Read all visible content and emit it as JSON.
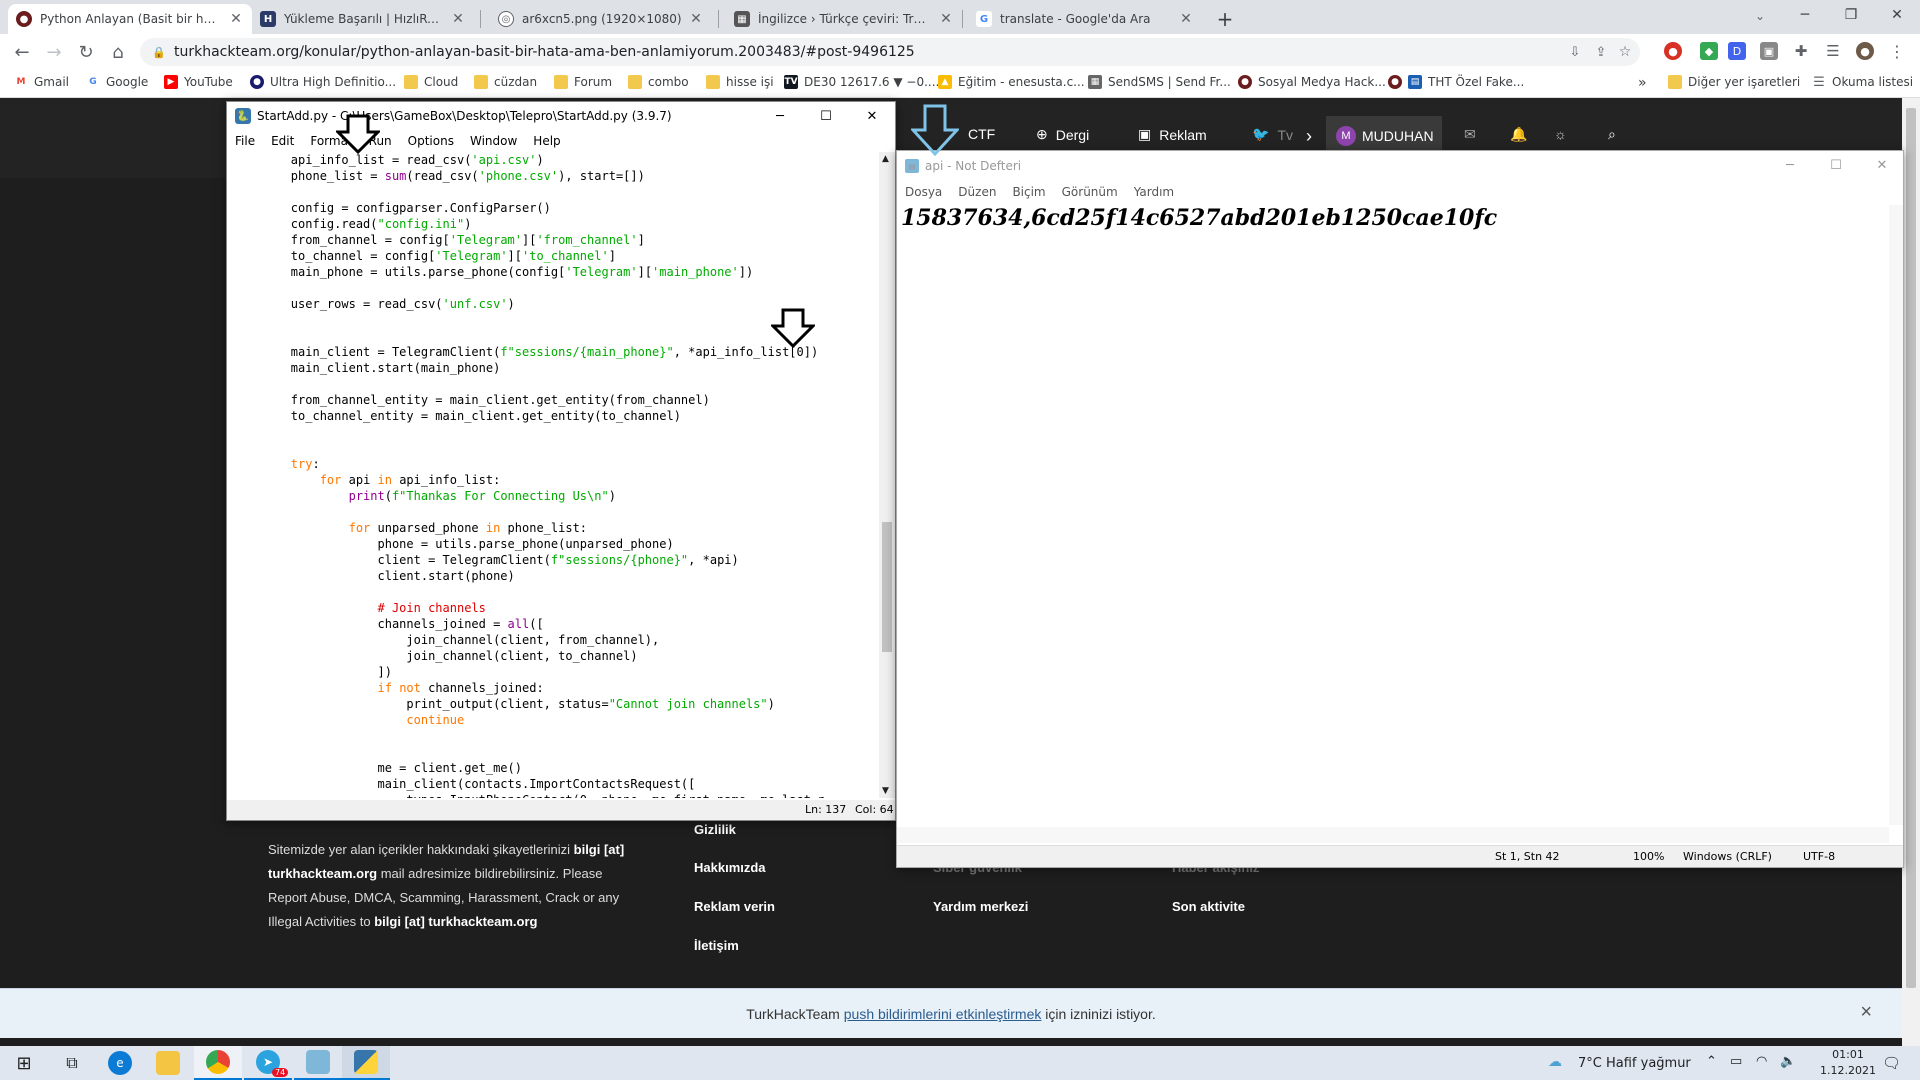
{
  "browser": {
    "tabs": [
      {
        "title": "Python Anlayan (Basit bir hata ama ben anlamıyorum)",
        "favicon": "tht-icon",
        "active": true
      },
      {
        "title": "Yükleme Başarılı | HızlıResim",
        "favicon": "h-icon",
        "active": false
      },
      {
        "title": "ar6xcn5.png (1920×1080)",
        "favicon": "globe-icon",
        "active": false
      },
      {
        "title": "İngilizce › Türkçe çeviri: Traceback",
        "favicon": "doc-icon",
        "active": false
      },
      {
        "title": "translate - Google'da Ara",
        "favicon": "google-icon",
        "active": false
      }
    ],
    "new_tab": "+",
    "url": "turkhackteam.org/konular/python-anlayan-basit-bir-hata-ama-ben-anlamiyorum.2003483/#post-9496125",
    "bookmarks": [
      {
        "label": "Gmail"
      },
      {
        "label": "Google"
      },
      {
        "label": "YouTube"
      },
      {
        "label": "Ultra High Definitio..."
      },
      {
        "label": "Cloud"
      },
      {
        "label": "cüzdan"
      },
      {
        "label": "Forum"
      },
      {
        "label": "combo"
      },
      {
        "label": "hisse işi"
      },
      {
        "label": "DE30 12617.6 ▼ −0...."
      },
      {
        "label": "Eğitim - enesusta.c..."
      },
      {
        "label": "SendSMS | Send Fr..."
      },
      {
        "label": "Sosyal Medya Hack..."
      },
      {
        "label": "THT Özel Fake..."
      }
    ],
    "bookmarks_more": "»",
    "other_bookmarks": "Diğer yer işaretleri",
    "reading_list": "Okuma listesi"
  },
  "site": {
    "nav": {
      "ctf": "CTF",
      "dergi": "Dergi",
      "reklam": "Reklam",
      "tw": "Tv",
      "user": "MUDUHAN",
      "user_initial": "M"
    },
    "footer": {
      "text_1": "Sitemizde yer alan içerikler hakkındaki şikayetlerinizi",
      "text_1b": "bilgi [at]",
      "text_2": "turkhackteam.org",
      "text_2b": "mail adresimize bildirebilirsiniz. Please",
      "text_3": "Report Abuse, DMCA, Scamming, Harassment, Crack or any",
      "text_4": "Illegal Activities to",
      "text_4b": "bilgi [at] turkhackteam.org",
      "col1": [
        "Gizlilik",
        "Hakkımızda",
        "Reklam verin",
        "İletişim"
      ],
      "col2": [
        "Siber güvenlik",
        "Yardım merkezi"
      ],
      "col3": [
        "Haber akışınız",
        "Son aktivite"
      ]
    },
    "notification": {
      "prefix": "TurkHackTeam",
      "link": "push bildirimlerini etkinleştirmek",
      "suffix": "için izninizi istiyor.",
      "close": "×"
    }
  },
  "idle": {
    "title": "StartAdd.py - C:\\Users\\GameBox\\Desktop\\Telepro\\StartAdd.py (3.9.7)",
    "menu": [
      "File",
      "Edit",
      "Format",
      "Run",
      "Options",
      "Window",
      "Help"
    ],
    "status_ln": "Ln: 137",
    "status_col": "Col: 64"
  },
  "notepad": {
    "title": "api - Not Defteri",
    "menu": [
      "Dosya",
      "Düzen",
      "Biçim",
      "Görünüm",
      "Yardım"
    ],
    "content": "15837634,6cd25f14c6527abd201eb1250cae10fc",
    "status_pos": "St 1, Stn 42",
    "status_zoom": "100%",
    "status_eol": "Windows (CRLF)",
    "status_enc": "UTF-8"
  },
  "taskbar": {
    "weather": "7°C  Hafif yağmur",
    "time": "01:01",
    "date": "1.12.2021",
    "telegram_badge": "74"
  }
}
